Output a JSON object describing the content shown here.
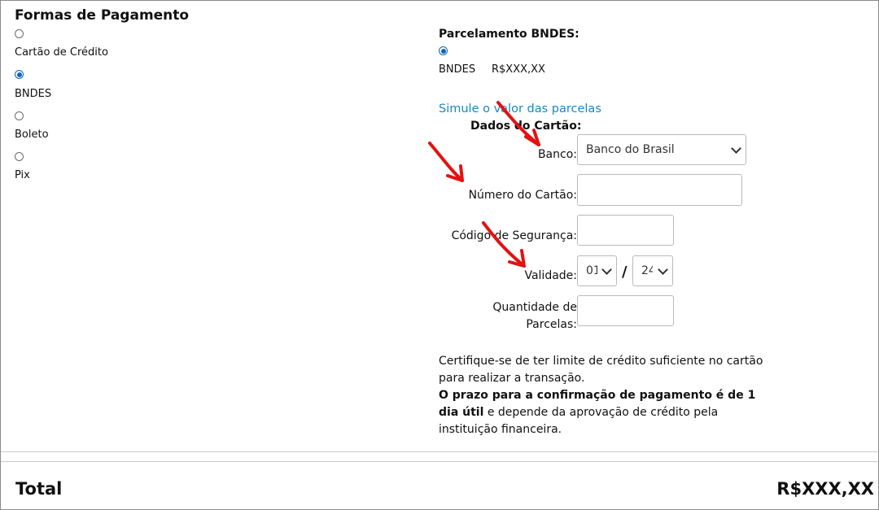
{
  "section": {
    "title": "Formas de Pagamento"
  },
  "payment_options": [
    {
      "label": "Cartão de Crédito",
      "checked": false
    },
    {
      "label": "BNDES",
      "checked": true
    },
    {
      "label": "Boleto",
      "checked": false
    },
    {
      "label": "Pix",
      "checked": false
    }
  ],
  "bndes": {
    "heading": "Parcelamento BNDES:",
    "option_label": "BNDES",
    "option_value": "R$XXX,XX",
    "simulate_link": "Simule o valor das parcelas"
  },
  "card": {
    "heading": "Dados do Cartão:",
    "bank_label": "Banco:",
    "bank_value": "Banco do Brasil",
    "number_label": "Número do Cartão:",
    "security_label": "Código de Segurança:",
    "validity_label": "Validade:",
    "month_value": "01",
    "year_value": "24",
    "slash": "/",
    "installments_label_1": "Quantidade de",
    "installments_label_2": "Parcelas:"
  },
  "notice": {
    "line1": "Certifique-se de ter limite de crédito suficiente no cartão",
    "line2": "para realizar a transação.",
    "bold": "O prazo para a confirmação de pagamento é de 1 dia útil",
    "rest": " e depende da aprovação de crédito pela instituição financeira."
  },
  "total": {
    "label": "Total",
    "value": "R$XXX,XX"
  },
  "colors": {
    "accent": "#0a66c2",
    "link": "#1b86c6",
    "arrow": "#e31212"
  }
}
